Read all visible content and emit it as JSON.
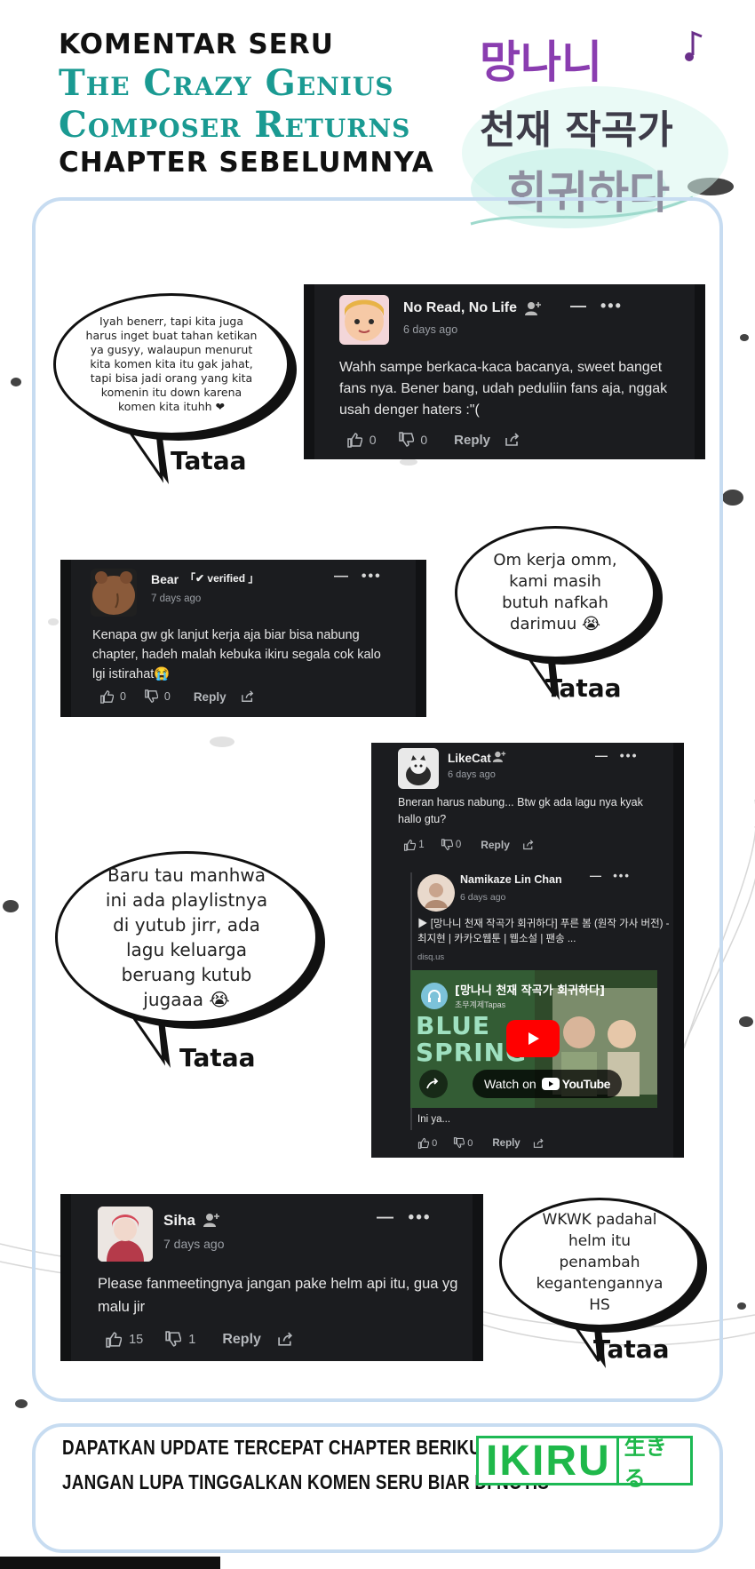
{
  "header": {
    "line1": "KOMENTAR SERU",
    "line2": "The Crazy Genius",
    "line3": "Composer Returns",
    "line4": "CHAPTER SEBELUMNYA"
  },
  "logo": {
    "line1": "망나니",
    "line2": "천재 작곡가",
    "line3": "회귀하다"
  },
  "bubbles": [
    {
      "text": "Iyah benerr, tapi kita juga harus inget buat tahan ketikan ya gusyy, walaupun menurut kita komen kita itu gak jahat, tapi bisa jadi orang yang kita komenin itu down karena komen kita ituhh ❤",
      "signature": "Tataa"
    },
    {
      "text": "Om kerja omm, kami masih butuh nafkah darimuu 😭",
      "signature": "Tataa"
    },
    {
      "text": "Baru tau manhwa ini ada playlistnya di yutub jirr, ada lagu keluarga beruang kutub jugaaa 😭",
      "signature": "Tataa"
    },
    {
      "text": "WKWK padahal helm itu penambah kegantengannya HS",
      "signature": "Tataa"
    }
  ],
  "comments": [
    {
      "name": "No Read, No Life",
      "time": "6 days ago",
      "text": "Wahh sampe berkaca-kaca bacanya, sweet banget fans nya. Bener bang, udah peduliin fans aja, nggak usah denger haters :\"(",
      "likes": "0",
      "dislikes": "0",
      "reply": "Reply"
    },
    {
      "name": "Bear",
      "badge": "「✔ verified 」",
      "time": "7 days ago",
      "text": "Kenapa gw gk lanjut kerja aja biar bisa nabung chapter, hadeh malah kebuka ikiru segala cok kalo lgi istirahat😭",
      "likes": "0",
      "dislikes": "0",
      "reply": "Reply"
    },
    {
      "name": "LikeCat",
      "time": "6 days ago",
      "text": "Bneran harus nabung... Btw gk ada lagu nya kyak hallo gtu?",
      "likes": "1",
      "dislikes": "0",
      "reply": "Reply",
      "reply_comment": {
        "name": "Namikaze Lin Chan",
        "time": "6 days ago",
        "link_text": "▶ [망나니 천재 작곡가 회귀하다] 푸른 봄 (원작 가사 버전) - 최지현 | 카카오웹툰 | 웹소설 | 팬송 ...",
        "link_domain": "disq.us",
        "video_title": "[망나니 천재 작곡가 회귀하다]",
        "video_channel": "초무계제Tapas",
        "video_bg_text": "BLUE SPRING",
        "watch_label": "Watch on",
        "youtube_label": "YouTube",
        "text": "Ini ya...",
        "likes": "0",
        "dislikes": "0",
        "reply": "Reply"
      }
    },
    {
      "name": "Siha",
      "time": "7 days ago",
      "text": "Please fanmeetingnya jangan pake helm api itu, gua yg malu jir",
      "likes": "15",
      "dislikes": "1",
      "reply": "Reply"
    }
  ],
  "footer": {
    "line1": "DAPATKAN UPDATE TERCEPAT CHAPTER BERIKUTNYA DI",
    "line2": "JANGAN LUPA TINGGALKAN KOMEN SERU BIAR DI NOTIS",
    "brand": "IKIRU",
    "brand_sub": "生きる"
  },
  "colors": {
    "teal": "#1a9a92",
    "frame": "#c7dcf1",
    "panel": "#1b1c1f",
    "brand_green": "#1fb84a",
    "logo_purple": "#8a3db0"
  }
}
